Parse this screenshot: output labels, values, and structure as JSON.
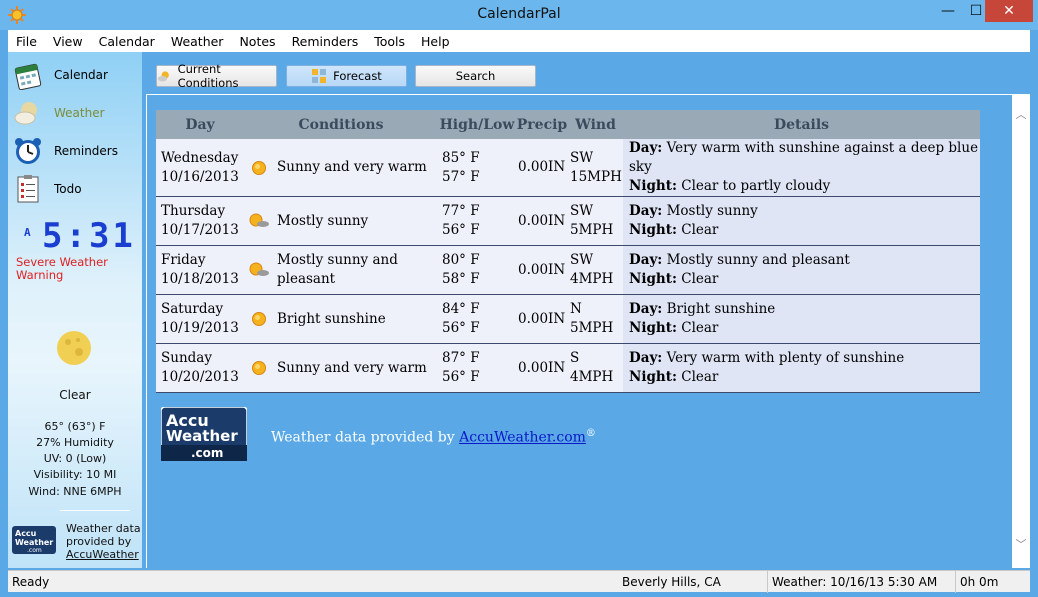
{
  "window": {
    "title": "CalendarPal",
    "minimize": "—",
    "maximize": "☐",
    "close": "✕"
  },
  "menu": [
    "File",
    "View",
    "Calendar",
    "Weather",
    "Notes",
    "Reminders",
    "Tools",
    "Help"
  ],
  "sidebar": {
    "nav": [
      {
        "label": "Calendar",
        "icon": "calendar-icon",
        "active": false
      },
      {
        "label": "Weather",
        "icon": "weather-icon",
        "active": true
      },
      {
        "label": "Reminders",
        "icon": "alarm-clock-icon",
        "active": false
      },
      {
        "label": "Todo",
        "icon": "todo-list-icon",
        "active": false
      }
    ],
    "clock": {
      "ampm": "A",
      "time": "5:31"
    },
    "warning": "Severe Weather Warning",
    "current": {
      "condition": "Clear",
      "temp": "65° (63°) F",
      "humidity": "27% Humidity",
      "uv": "UV: 0 (Low)",
      "visibility": "Visibility: 10 MI",
      "wind": "Wind: NNE 6MPH"
    },
    "credit_line1": "Weather data",
    "credit_line2": "provided by",
    "credit_link": "AccuWeather"
  },
  "toolbar": {
    "current": "Current Conditions",
    "forecast": "Forecast",
    "search": "Search"
  },
  "table": {
    "headers": {
      "day": "Day",
      "conditions": "Conditions",
      "highlow": "High/Low",
      "precip": "Precip",
      "wind": "Wind",
      "details": "Details"
    },
    "day_prefix": "Day:",
    "night_prefix": "Night:",
    "rows": [
      {
        "day": "Wednesday",
        "date": "10/16/2013",
        "icon": "sun",
        "cond": "Sunny and very warm",
        "high": "85° F",
        "low": "57° F",
        "precip": "0.00IN",
        "wind_dir": "SW",
        "wind_speed": "15MPH",
        "day_detail": "Very warm with sunshine against a deep blue sky",
        "night_detail": "Clear to partly cloudy"
      },
      {
        "day": "Thursday",
        "date": "10/17/2013",
        "icon": "partly",
        "cond": "Mostly sunny",
        "high": "77° F",
        "low": "56° F",
        "precip": "0.00IN",
        "wind_dir": "SW",
        "wind_speed": "5MPH",
        "day_detail": "Mostly sunny",
        "night_detail": "Clear"
      },
      {
        "day": "Friday",
        "date": "10/18/2013",
        "icon": "partly",
        "cond": "Mostly sunny and pleasant",
        "high": "80° F",
        "low": "58° F",
        "precip": "0.00IN",
        "wind_dir": "SW",
        "wind_speed": "4MPH",
        "day_detail": "Mostly sunny and pleasant",
        "night_detail": "Clear"
      },
      {
        "day": "Saturday",
        "date": "10/19/2013",
        "icon": "sun",
        "cond": "Bright sunshine",
        "high": "84° F",
        "low": "56° F",
        "precip": "0.00IN",
        "wind_dir": "N",
        "wind_speed": "5MPH",
        "day_detail": "Bright sunshine",
        "night_detail": "Clear"
      },
      {
        "day": "Sunday",
        "date": "10/20/2013",
        "icon": "sun",
        "cond": "Sunny and very warm",
        "high": "87° F",
        "low": "56° F",
        "precip": "0.00IN",
        "wind_dir": "S",
        "wind_speed": "4MPH",
        "day_detail": "Very warm with plenty of sunshine",
        "night_detail": "Clear"
      }
    ]
  },
  "logo": {
    "line1": "Accu",
    "line2": "Weather",
    "line3": ".com"
  },
  "credit": {
    "text": "Weather data provided by ",
    "link": "AccuWeather.com",
    "mark": "®"
  },
  "status": {
    "ready": "Ready",
    "location": "Beverly Hills, CA",
    "updated": "Weather: 10/16/13 5:30 AM",
    "duration": "0h 0m"
  },
  "colors": {
    "accent": "#5aa9e6",
    "header": "#9aa9b6",
    "warning": "#e02020",
    "clock": "#1a3fd0",
    "logo": "#1b3c6b"
  }
}
